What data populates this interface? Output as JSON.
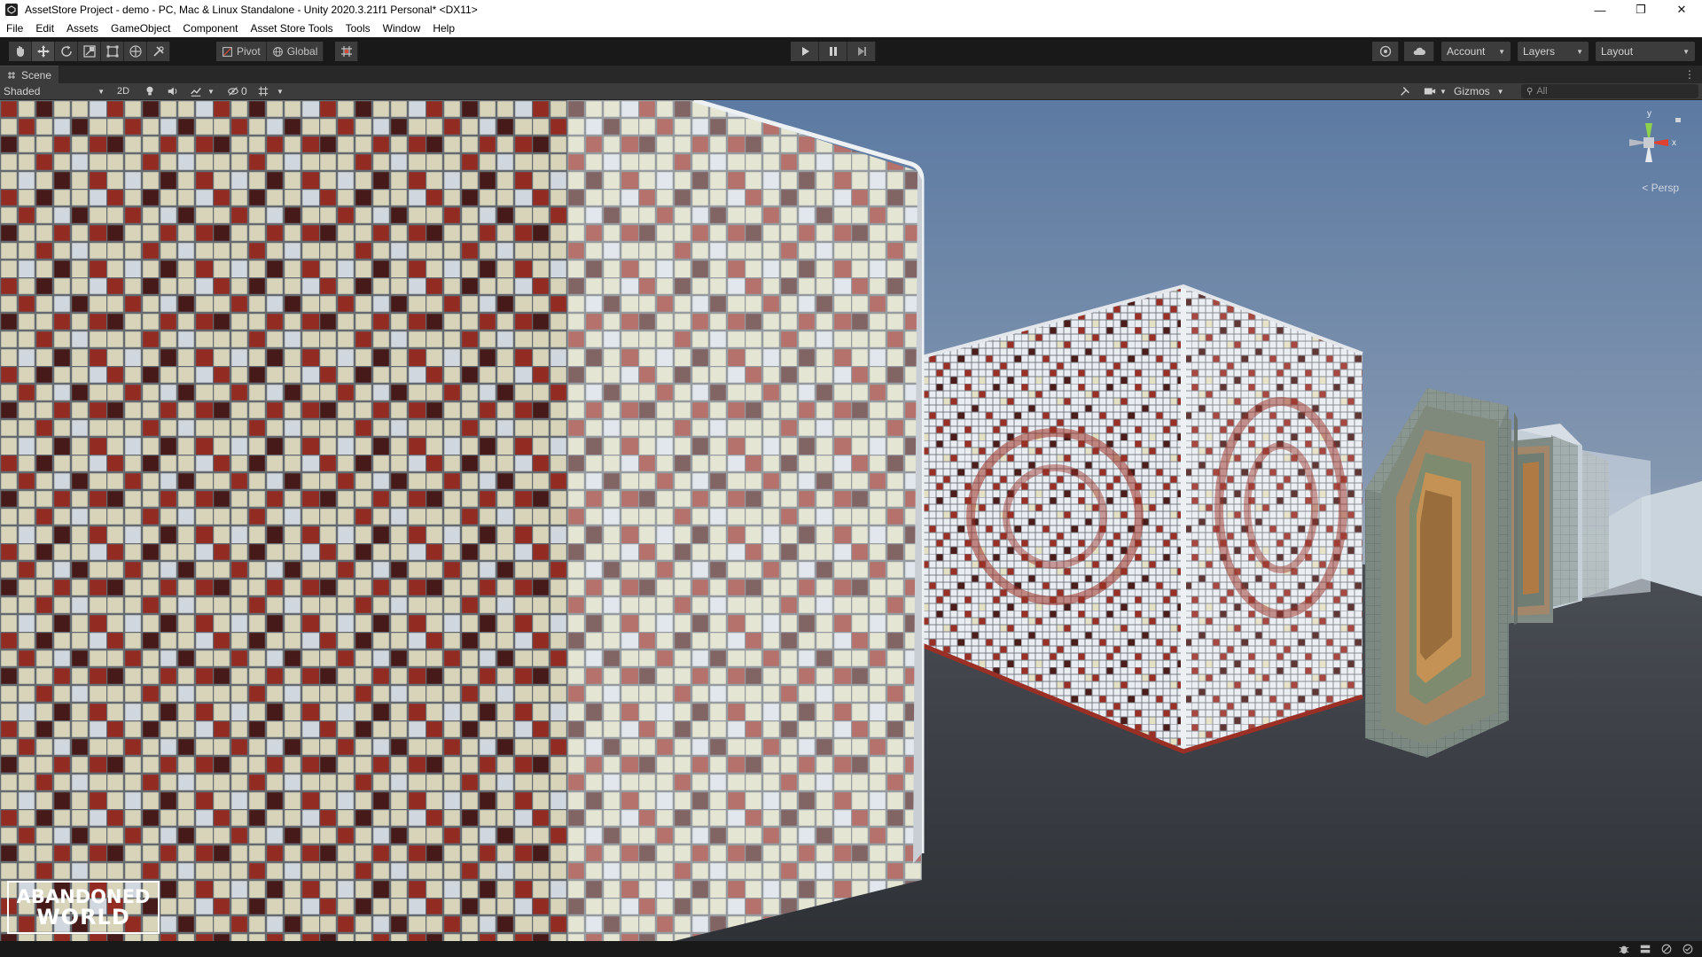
{
  "window": {
    "title": "AssetStore Project - demo - PC, Mac & Linux Standalone - Unity 2020.3.21f1 Personal* <DX11>",
    "minimize_glyph": "—",
    "maximize_glyph": "❐",
    "close_glyph": "✕"
  },
  "menu": [
    "File",
    "Edit",
    "Assets",
    "GameObject",
    "Component",
    "Asset Store Tools",
    "Tools",
    "Window",
    "Help"
  ],
  "toolbar": {
    "pivot_label": "Pivot",
    "global_label": "Global",
    "account_label": "Account",
    "layers_label": "Layers",
    "layout_label": "Layout"
  },
  "scene_tab": {
    "label": "Scene"
  },
  "scene_bar": {
    "draw_mode": "Shaded",
    "two_d_label": "2D",
    "hidden_count": "0",
    "gizmos_label": "Gizmos",
    "search_placeholder": "All"
  },
  "viewport": {
    "projection_label": "< Persp",
    "gizmo_axis_y": "y",
    "gizmo_axis_x": "x",
    "watermark_line1": "ABANDONED",
    "watermark_line2": "WORLD"
  },
  "colors": {
    "sky_top": "#5c7aa2",
    "sky_horizon": "#a9b3bf",
    "ground": "#363a40",
    "tile_red": "#9a2f25",
    "tile_dark": "#4a1c1a",
    "tile_cream": "#e4e0c4",
    "tile_white": "#e9edf2"
  }
}
